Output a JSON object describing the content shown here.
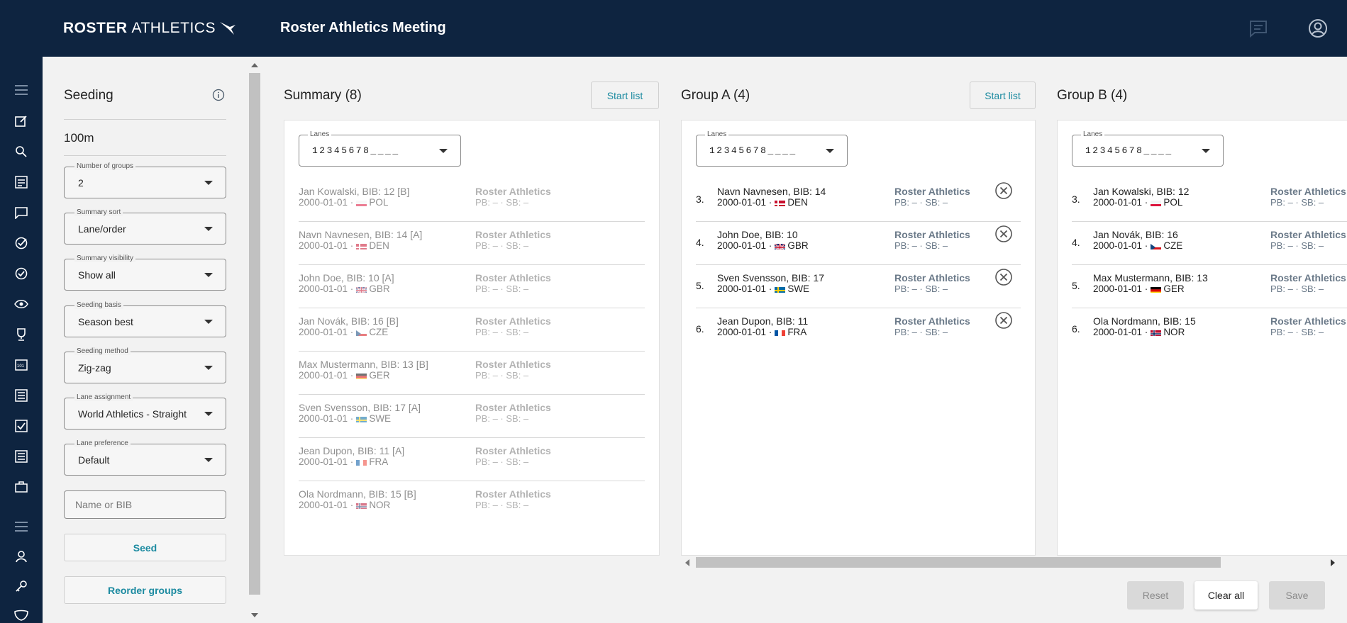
{
  "header": {
    "logo_bold": "ROSTER",
    "logo_thin": "ATHLETICS",
    "title": "Roster Athletics Meeting",
    "icons": [
      "chat-icon",
      "account-icon"
    ]
  },
  "sidebar": {
    "icons": [
      "menu-icon",
      "edit-icon",
      "search-icon",
      "list-icon",
      "message-icon",
      "check-circle-icon",
      "check-icon",
      "eye-icon",
      "trophy-icon",
      "scoreboard-icon",
      "document-icon",
      "checkbox-icon",
      "report-icon",
      "briefcase-icon",
      "menu-icon",
      "person-icon",
      "key-icon",
      "shield-icon"
    ]
  },
  "seeding": {
    "title": "Seeding",
    "event": "100m",
    "fields": [
      {
        "label": "Number of groups",
        "value": "2"
      },
      {
        "label": "Summary sort",
        "value": "Lane/order"
      },
      {
        "label": "Summary visibility",
        "value": "Show all"
      },
      {
        "label": "Seeding basis",
        "value": "Season best"
      },
      {
        "label": "Seeding method",
        "value": "Zig-zag"
      },
      {
        "label": "Lane assignment",
        "value": "World Athletics - Straight"
      },
      {
        "label": "Lane preference",
        "value": "Default"
      }
    ],
    "search_placeholder": "Name or BIB",
    "seed_label": "Seed",
    "reorder_label": "Reorder groups"
  },
  "summary": {
    "title": "Summary (8)",
    "start_list_label": "Start list",
    "lanes_label": "Lanes",
    "lanes_value": "12345678____",
    "rows": [
      {
        "name": "Jan Kowalski, BIB: 12 [B]",
        "date": "2000-01-01 ·",
        "country": "POL",
        "club": "Roster Athletics",
        "pb": "PB: – · SB: –"
      },
      {
        "name": "Navn Navnesen, BIB: 14 [A]",
        "date": "2000-01-01 ·",
        "country": "DEN",
        "club": "Roster Athletics",
        "pb": "PB: – · SB: –"
      },
      {
        "name": "John Doe, BIB: 10 [A]",
        "date": "2000-01-01 ·",
        "country": "GBR",
        "club": "Roster Athletics",
        "pb": "PB: – · SB: –"
      },
      {
        "name": "Jan Novák, BIB: 16 [B]",
        "date": "2000-01-01 ·",
        "country": "CZE",
        "club": "Roster Athletics",
        "pb": "PB: – · SB: –"
      },
      {
        "name": "Max Mustermann, BIB: 13 [B]",
        "date": "2000-01-01 ·",
        "country": "GER",
        "club": "Roster Athletics",
        "pb": "PB: – · SB: –"
      },
      {
        "name": "Sven Svensson, BIB: 17 [A]",
        "date": "2000-01-01 ·",
        "country": "SWE",
        "club": "Roster Athletics",
        "pb": "PB: – · SB: –"
      },
      {
        "name": "Jean Dupon, BIB: 11 [A]",
        "date": "2000-01-01 ·",
        "country": "FRA",
        "club": "Roster Athletics",
        "pb": "PB: – · SB: –"
      },
      {
        "name": "Ola Nordmann, BIB: 15 [B]",
        "date": "2000-01-01 ·",
        "country": "NOR",
        "club": "Roster Athletics",
        "pb": "PB: – · SB: –"
      }
    ]
  },
  "group_a": {
    "title": "Group A (4)",
    "start_list_label": "Start list",
    "lanes_label": "Lanes",
    "lanes_value": "12345678____",
    "rows": [
      {
        "lane": "3.",
        "name": "Navn Navnesen, BIB: 14",
        "date": "2000-01-01 ·",
        "country": "DEN",
        "club": "Roster Athletics",
        "pb": "PB: – · SB: –"
      },
      {
        "lane": "4.",
        "name": "John Doe, BIB: 10",
        "date": "2000-01-01 ·",
        "country": "GBR",
        "club": "Roster Athletics",
        "pb": "PB: – · SB: –"
      },
      {
        "lane": "5.",
        "name": "Sven Svensson, BIB: 17",
        "date": "2000-01-01 ·",
        "country": "SWE",
        "club": "Roster Athletics",
        "pb": "PB: – · SB: –"
      },
      {
        "lane": "6.",
        "name": "Jean Dupon, BIB: 11",
        "date": "2000-01-01 ·",
        "country": "FRA",
        "club": "Roster Athletics",
        "pb": "PB: – · SB: –"
      }
    ]
  },
  "group_b": {
    "title": "Group B (4)",
    "lanes_label": "Lanes",
    "lanes_value": "12345678____",
    "rows": [
      {
        "lane": "3.",
        "name": "Jan Kowalski, BIB: 12",
        "date": "2000-01-01 ·",
        "country": "POL",
        "club": "Roster Athletics",
        "pb": "PB: – · SB: –"
      },
      {
        "lane": "4.",
        "name": "Jan Novák, BIB: 16",
        "date": "2000-01-01 ·",
        "country": "CZE",
        "club": "Roster Athletics",
        "pb": "PB: – · SB: –"
      },
      {
        "lane": "5.",
        "name": "Max Mustermann, BIB: 13",
        "date": "2000-01-01 ·",
        "country": "GER",
        "club": "Roster Athletics",
        "pb": "PB: – · SB: –"
      },
      {
        "lane": "6.",
        "name": "Ola Nordmann, BIB: 15",
        "date": "2000-01-01 ·",
        "country": "NOR",
        "club": "Roster Athletics",
        "pb": "PB: – · SB: –"
      }
    ]
  },
  "footer": {
    "reset_label": "Reset",
    "clear_label": "Clear all",
    "save_label": "Save"
  },
  "colors": {
    "header_bg": "#0e2440",
    "accent": "#1b8aa0",
    "club_text": "#6b7a89"
  }
}
